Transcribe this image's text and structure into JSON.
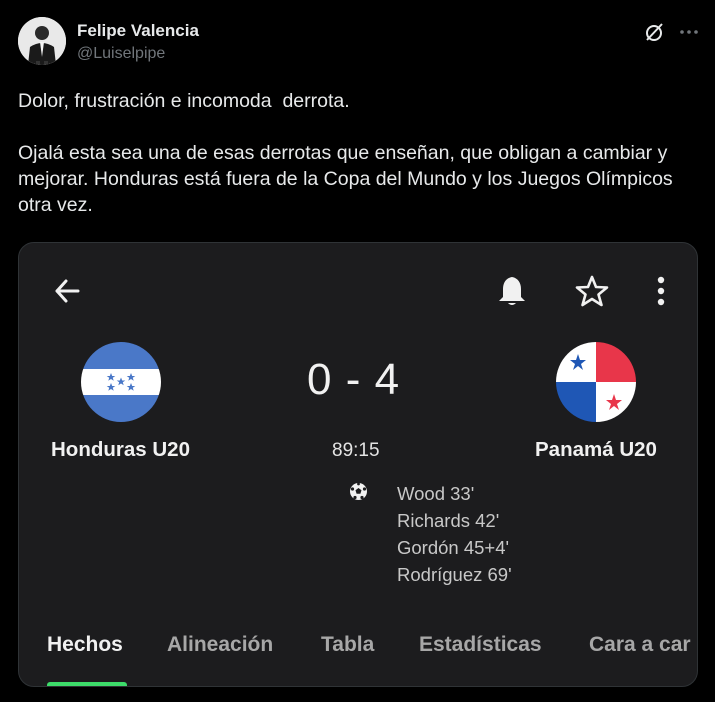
{
  "tweet": {
    "author_name": "Felipe Valencia",
    "author_handle": "@Luiselpipe",
    "paragraphs": [
      "Dolor, frustración e incomoda  derrota.",
      "Ojalá esta sea una de esas derrotas que enseñan, que obligan a cambiar y mejorar. Honduras está fuera de la Copa del Mundo y los Juegos Olímpicos otra vez."
    ]
  },
  "match": {
    "home_team": "Honduras U20",
    "away_team": "Panamá U20",
    "score": "0 - 4",
    "clock": "89:15",
    "scorers": [
      "Wood 33'",
      "Richards 42'",
      "Gordón 45+4'",
      "Rodríguez 69'"
    ]
  },
  "tabs": [
    "Hechos",
    "Alineación",
    "Tabla",
    "Estadísticas",
    "Cara a car"
  ],
  "active_tab": "Hechos",
  "colors": {
    "background": "#000000",
    "card_background": "#1c1c1e",
    "tab_indicator": "#3ddc6a",
    "honduras_blue": "#4a78c8",
    "panama_red": "#e8364a",
    "panama_blue": "#1f57b5"
  },
  "icons": {
    "back": "arrow-left-icon",
    "notifications": "bell-icon",
    "favorite": "star-icon",
    "menu": "kebab-menu-icon",
    "goal": "soccer-ball-icon",
    "grok": "grok-icon",
    "more": "more-horizontal-icon"
  }
}
